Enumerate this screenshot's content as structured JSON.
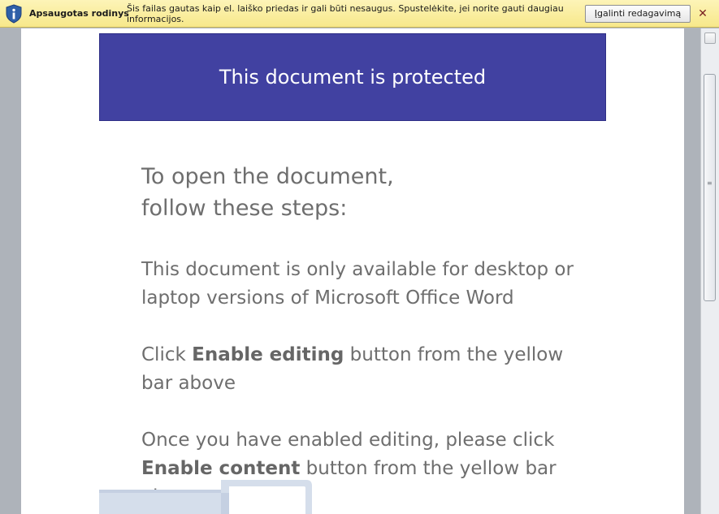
{
  "protected_view_bar": {
    "icon": "info-shield-icon",
    "title": "Apsaugotas rodinys",
    "message": "Šis failas gautas kaip el. laiško priedas ir gali būti nesaugus. Spustelėkite, jei norite gauti daugiau informacijos.",
    "enable_button_prefix": "Į",
    "enable_button_rest": "galinti redagavimą",
    "close_icon": "close-icon",
    "colors": {
      "bar": "#f7e88a",
      "shield": "#2f5fa8"
    }
  },
  "document": {
    "banner_text": "This document is protected",
    "heading_line1": "To open the document,",
    "heading_line2": "follow these steps:",
    "para1": "This document is only available for desktop or laptop versions of Microsoft Office Word",
    "para2_pre": "Click ",
    "para2_bold": "Enable editing",
    "para2_post": " button from the yellow bar above",
    "para3_pre": "Once you have enabled editing, please click ",
    "para3_bold": "Enable content",
    "para3_post": " button from the yellow bar above",
    "colors": {
      "banner": "#4141a1",
      "text": "#6e6e6e"
    }
  },
  "scrollbar": {
    "split_icon": "split-box-icon",
    "grip_icon": "grip-icon"
  }
}
